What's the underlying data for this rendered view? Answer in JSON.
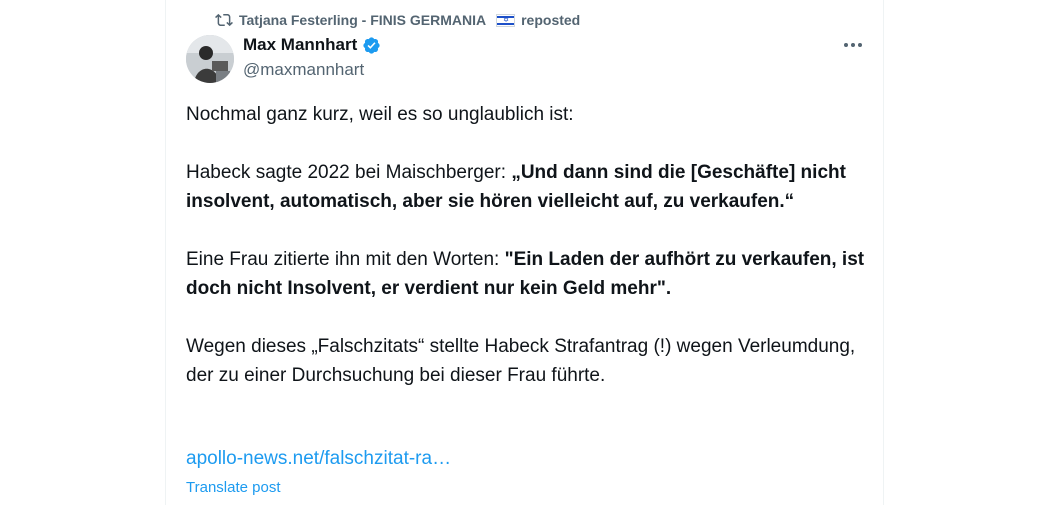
{
  "repost": {
    "icon": "repost-icon",
    "user": "Tatjana Festerling - FINIS GERMANIA",
    "flag": "israel-flag",
    "label": "reposted"
  },
  "author": {
    "name": "Max Mannhart",
    "handle": "@maxmannhart",
    "verified_icon": "verified-badge-icon",
    "verified_color": "#1d9bf0"
  },
  "post": {
    "p1": "Nochmal ganz kurz, weil es so unglaublich ist:",
    "p2_plain": "Habeck sagte 2022 bei Maischberger: ",
    "p2_bold": "„Und dann sind die [Geschäfte] nicht insolvent, automatisch, aber sie hören vielleicht auf, zu verkaufen.“",
    "p3_plain": "Eine Frau zitierte ihn mit den Worten: ",
    "p3_bold": "\"Ein Laden der aufhört zu verkaufen, ist doch nicht Insolvent, er verdient nur kein Geld mehr\".",
    "p4": "Wegen dieses „Falschzitats“ stellte Habeck Strafantrag (!) wegen Verleumdung, der zu einer Durchsuchung bei dieser Frau führte.",
    "link": "apollo-news.net/falschzitat-ra…",
    "translate": "Translate post"
  },
  "colors": {
    "text": "#0f1419",
    "secondary": "#536471",
    "link": "#1d9bf0"
  }
}
